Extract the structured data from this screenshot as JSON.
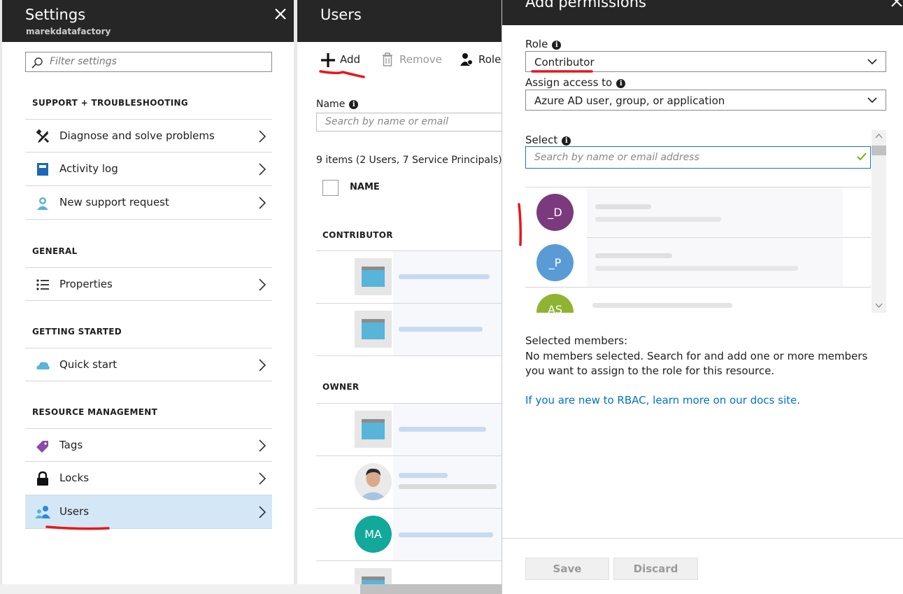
{
  "settings": {
    "title": "Settings",
    "subtitle": "marekdatafactory",
    "filter_placeholder": "Filter settings",
    "sections": [
      {
        "heading": "SUPPORT + TROUBLESHOOTING",
        "items": [
          "Diagnose and solve problems",
          "Activity log",
          "New support request"
        ]
      },
      {
        "heading": "GENERAL",
        "items": [
          "Properties"
        ]
      },
      {
        "heading": "GETTING STARTED",
        "items": [
          "Quick start"
        ]
      },
      {
        "heading": "RESOURCE MANAGEMENT",
        "items": [
          "Tags",
          "Locks",
          "Users"
        ]
      }
    ]
  },
  "users": {
    "title": "Users",
    "toolbar": {
      "add": "Add",
      "remove": "Remove",
      "roles": "Roles"
    },
    "name_label": "Name",
    "search_placeholder": "Search by name or email",
    "items_count": "9 items (2 Users, 7 Service Principals)",
    "column_name": "NAME",
    "groups": {
      "contributor": "CONTRIBUTOR",
      "owner": "OWNER"
    },
    "avatar_initials": "MA"
  },
  "permissions": {
    "title": "Add permissions",
    "role_label": "Role",
    "role_value": "Contributor",
    "assign_label": "Assign access to",
    "assign_value": "Azure AD user, group, or application",
    "select_label": "Select",
    "select_placeholder": "Search by name or email address",
    "results": [
      {
        "initials": "_D",
        "color": "#7b3a7d"
      },
      {
        "initials": "_P",
        "color": "#5b9bd5"
      },
      {
        "initials": "AS",
        "color": "#8fb431"
      }
    ],
    "selected_heading": "Selected members:",
    "selected_text": "No members selected. Search for and add one or more members you want to assign to the role for this resource.",
    "rbac_link": "If you are new to RBAC, learn more on our docs site.",
    "save": "Save",
    "discard": "Discard"
  }
}
